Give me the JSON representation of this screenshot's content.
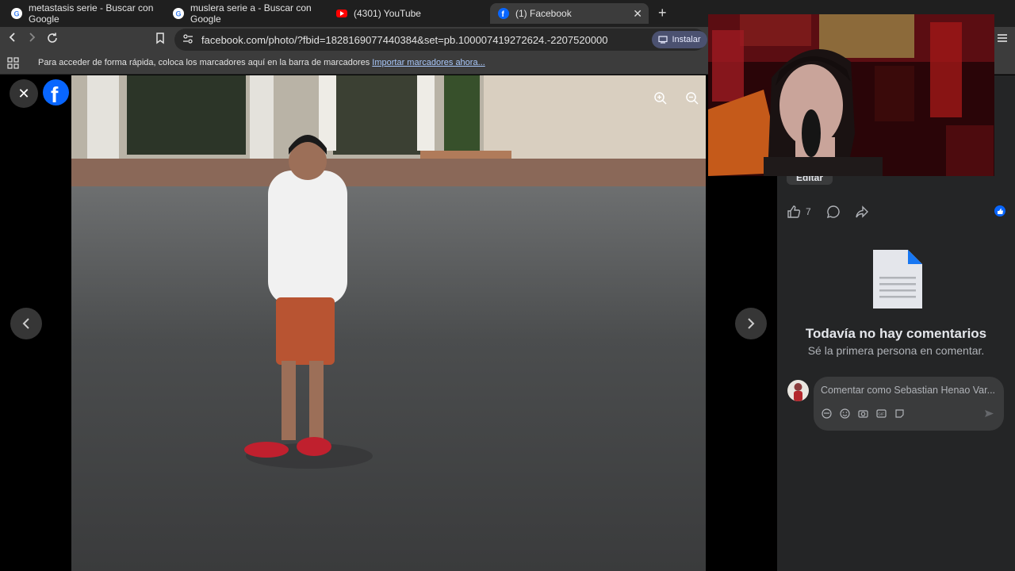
{
  "tabs": [
    {
      "title": "metastasis serie - Buscar con Google",
      "icon": "google-icon"
    },
    {
      "title": "muslera serie a - Buscar con Google",
      "icon": "google-icon"
    },
    {
      "title": "(4301) YouTube",
      "icon": "youtube-icon"
    },
    {
      "title": "(1) Facebook",
      "icon": "facebook-icon"
    }
  ],
  "toolbar": {
    "url": "facebook.com/photo/?fbid=1828169077440384&set=pb.100007419272624.-2207520000",
    "install_label": "Instalar"
  },
  "bookmarks": {
    "text": "Para acceder de forma rápida, coloca los marcadores aquí en la barra de marcadores",
    "link": "Importar marcadores ahora..."
  },
  "post": {
    "edit_label": "Editar",
    "like_count": "7"
  },
  "comments": {
    "empty_title": "Todavía no hay comentarios",
    "empty_subtitle": "Sé la primera persona en comentar.",
    "placeholder": "Comentar como Sebastian Henao Var..."
  },
  "colors": {
    "facebook_blue": "#0866ff",
    "panel_bg": "#242526",
    "browser_toolbar": "#3c3c3c"
  }
}
